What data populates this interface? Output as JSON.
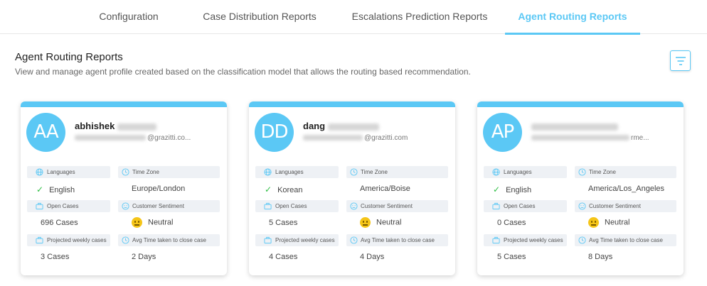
{
  "tabs": [
    {
      "label": "Configuration"
    },
    {
      "label": "Case Distribution Reports"
    },
    {
      "label": "Escalations Prediction Reports"
    },
    {
      "label": "Agent Routing Reports"
    }
  ],
  "active_tab": "Agent Routing Reports",
  "header": {
    "title": "Agent Routing Reports",
    "subtitle": "View and manage agent profile created based on the classification model that allows the routing based recommendation."
  },
  "labels": {
    "languages": "Languages",
    "time_zone": "Time Zone",
    "open_cases": "Open Cases",
    "customer_sentiment": "Customer Sentiment",
    "projected_weekly": "Projected weekly cases",
    "avg_time": "Avg Time taken to close case"
  },
  "agents": [
    {
      "initials": "AA",
      "name": "abhishek",
      "email_suffix": "@grazitti.co...",
      "language": "English",
      "time_zone": "Europe/London",
      "open_cases": "696 Cases",
      "sentiment": "Neutral",
      "projected": "3 Cases",
      "avg_time": "2 Days"
    },
    {
      "initials": "DD",
      "name": "dang",
      "email_suffix": "@grazitti.com",
      "language": "Korean",
      "time_zone": "America/Boise",
      "open_cases": "5 Cases",
      "sentiment": "Neutral",
      "projected": "4 Cases",
      "avg_time": "4 Days"
    },
    {
      "initials": "AP",
      "name": "",
      "email_suffix": "rme...",
      "language": "English",
      "time_zone": "America/Los_Angeles",
      "open_cases": "0 Cases",
      "sentiment": "Neutral",
      "projected": "5 Cases",
      "avg_time": "8 Days"
    }
  ],
  "colors": {
    "accent": "#5bc8f5",
    "check": "#2fbf44",
    "emoji": "#f5c518"
  }
}
